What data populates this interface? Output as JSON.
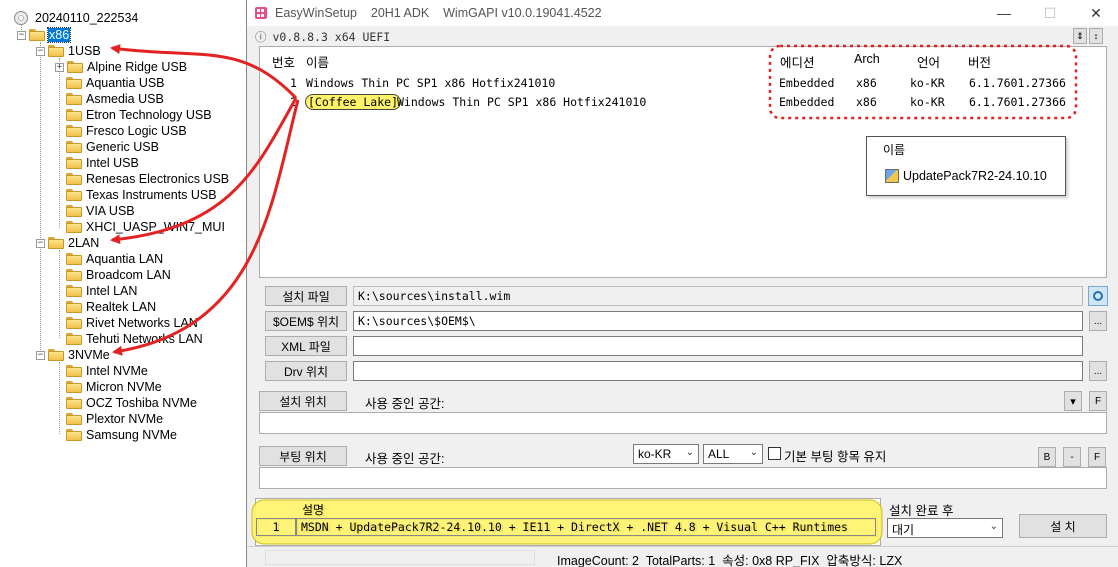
{
  "tree": {
    "root_label": "20240110_222534",
    "x86_label": "x86",
    "usb": {
      "label": "1USB",
      "items": [
        "Alpine Ridge USB",
        "Aquantia USB",
        "Asmedia USB",
        "Etron Technology USB",
        "Fresco Logic USB",
        "Generic USB",
        "Intel USB",
        "Renesas Electronics USB",
        "Texas Instruments USB",
        "VIA USB",
        "XHCI_UASP_WIN7_MUI"
      ]
    },
    "lan": {
      "label": "2LAN",
      "items": [
        "Aquantia LAN",
        "Broadcom LAN",
        "Intel LAN",
        "Realtek LAN",
        "Rivet Networks LAN",
        "Tehuti Networks LAN"
      ]
    },
    "nvme": {
      "label": "3NVMe",
      "items": [
        "Intel NVMe",
        "Micron NVMe",
        "OCZ Toshiba NVMe",
        "Plextor NVMe",
        "Samsung NVMe"
      ]
    }
  },
  "window": {
    "title": "EasyWinSetup    20H1 ADK    WimGAPI v10.0.19041.4522",
    "minimize": "—",
    "maximize": "☐",
    "close": "✕",
    "version_line": "v0.8.8.3 x64 UEFI",
    "info_icon": "ⓘ",
    "spin_up": "⇕",
    "spin_arrows": "↕"
  },
  "image_list": {
    "headers": {
      "num": "번호",
      "name": "이름",
      "edition": "에디션",
      "arch": "Arch",
      "lang": "언어",
      "version": "버전"
    },
    "rows": [
      {
        "num": "1",
        "tag": "",
        "name": "Windows Thin PC SP1 x86 Hotfix241010",
        "edition": "Embedded",
        "arch": "x86",
        "lang": "ko-KR",
        "version": "6.1.7601.27366"
      },
      {
        "num": "2",
        "tag": "[Coffee Lake]",
        "name": "Windows Thin PC SP1 x86 Hotfix241010",
        "edition": "Embedded",
        "arch": "x86",
        "lang": "ko-KR",
        "version": "6.1.7601.27366"
      }
    ]
  },
  "popup": {
    "header": "이름",
    "item": "UpdatePack7R2-24.10.10"
  },
  "fields": {
    "install_file_btn": "설치 파일",
    "install_file_value": "K:\\sources\\install.wim",
    "oem_btn": "$OEM$ 위치",
    "oem_value": "K:\\sources\\$OEM$\\",
    "xml_btn": "XML 파일",
    "xml_value": "",
    "drv_btn": "Drv 위치",
    "drv_value": "",
    "dots": "...",
    "install_loc_btn": "설치 위치",
    "install_used_label": "사용 중인 공간:",
    "boot_loc_btn": "부팅 위치",
    "boot_used_label": "사용 중인 공간:",
    "lang_select": "ko-KR",
    "all_select": "ALL",
    "keep_boot_label": "기본 부팅 항목 유지",
    "btn_b": "B",
    "btn_minus": "-",
    "btn_f": "F",
    "dropdown_arrow": "▾"
  },
  "description": {
    "header": "설명",
    "num": "1",
    "value": "MSDN + UpdatePack7R2-24.10.10 + IE11 + DirectX + .NET 4.8 + Visual C++ Runtimes"
  },
  "after_install": {
    "label": "설치 완료 후",
    "select": "대기",
    "install_btn": "설 치"
  },
  "status": {
    "text": "ImageCount: 2  TotalParts: 1  속성: 0x8 RP_FIX  압축방식: LZX"
  },
  "colors": {
    "selection": "#0078d7",
    "highlight_yellow": "#fff36a",
    "annotation_red": "#e32222",
    "dotted_red": "#e32222"
  }
}
